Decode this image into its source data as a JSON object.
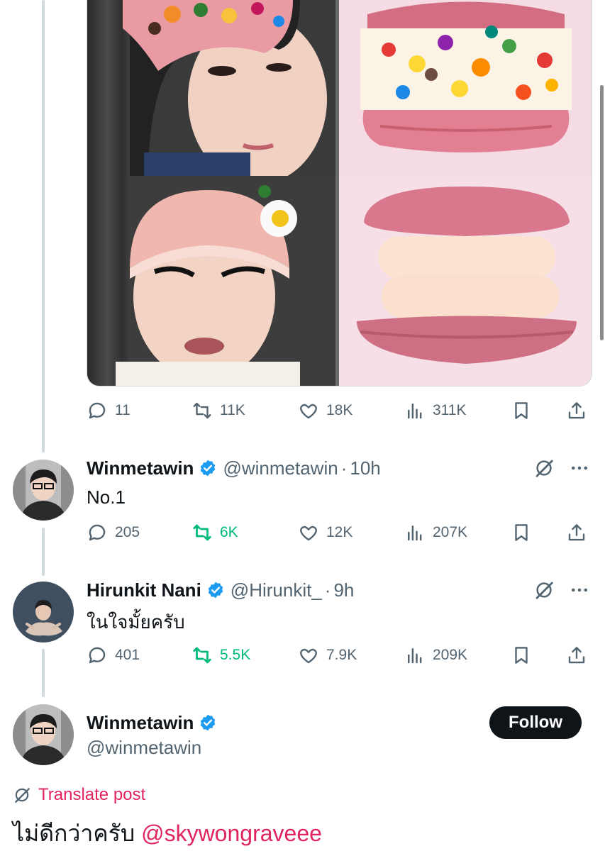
{
  "colors": {
    "accent_pink": "#e0245e",
    "verified_blue": "#1d9bf0",
    "repost_green": "#00ba7c",
    "muted_gray": "#536471",
    "follow_bg": "#0f1419"
  },
  "media": {
    "tiles": [
      "person-photo-top",
      "macaron-top",
      "person-photo-bottom",
      "macaron-bottom"
    ]
  },
  "first_post_actions": {
    "replies": "11",
    "reposts": "11K",
    "likes": "18K",
    "views": "311K"
  },
  "posts": [
    {
      "name": "Winmetawin",
      "handle": "@winmetawin",
      "time": "10h",
      "text": "No.1",
      "replies": "205",
      "reposts": "6K",
      "likes": "12K",
      "views": "207K",
      "reposted": true
    },
    {
      "name": "Hirunkit Nani",
      "handle": "@Hirunkit_",
      "time": "9h",
      "text": "ในใจมั้ยครับ",
      "replies": "401",
      "reposts": "5.5K",
      "likes": "7.9K",
      "views": "209K",
      "reposted": true
    }
  ],
  "main_post": {
    "name": "Winmetawin",
    "handle": "@winmetawin",
    "follow_label": "Follow",
    "translate_label": "Translate post",
    "text": "ไม่ดีกว่าครับ",
    "mention": "@skywongraveee"
  },
  "separator": "·",
  "icons": [
    "reply-icon",
    "repost-icon",
    "like-icon",
    "views-icon",
    "bookmark-icon",
    "share-icon",
    "verified-icon",
    "grok-icon",
    "more-icon",
    "translate-icon"
  ]
}
